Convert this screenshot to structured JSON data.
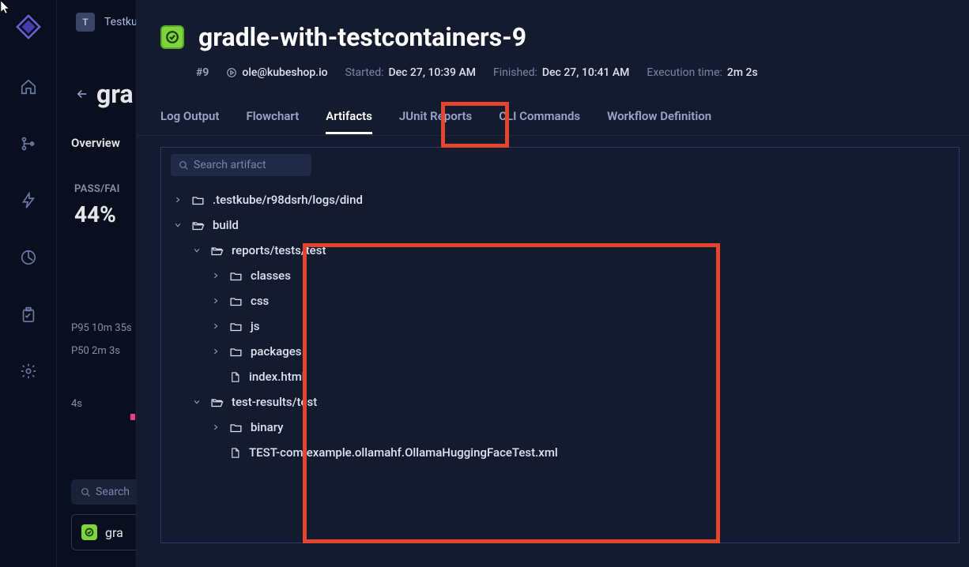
{
  "cursor": {
    "visible": true
  },
  "topbar": {
    "org_initial": "T",
    "org_name": "Testkub"
  },
  "partial": {
    "title": "gra",
    "overview": "Overview",
    "pass_fail_label": "PASS/FAI",
    "pass_fail_pct": "44%",
    "p95": "P95 10m 35s",
    "p50": "P50 2m 3s",
    "p4s": "4s",
    "search_placeholder": "Search",
    "row_name": "gra"
  },
  "main": {
    "title": "gradle-with-testcontainers-9",
    "run_number": "#9",
    "author": "ole@kubeshop.io",
    "started_label": "Started:",
    "started_value": "Dec 27, 10:39 AM",
    "finished_label": "Finished:",
    "finished_value": "Dec 27, 10:41 AM",
    "exec_label": "Execution time:",
    "exec_value": "2m 2s"
  },
  "tabs": {
    "log": "Log Output",
    "flow": "Flowchart",
    "artifacts": "Artifacts",
    "junit": "JUnit Reports",
    "cli": "CLI Commands",
    "workflow": "Workflow Definition"
  },
  "search": {
    "placeholder": "Search artifact"
  },
  "tree": {
    "n1": ".testkube/r98dsrh/logs/dind",
    "n2": "build",
    "n3": "reports/tests/test",
    "n4": "classes",
    "n5": "css",
    "n6": "js",
    "n7": "packages",
    "n8": "index.html",
    "n9": "test-results/test",
    "n10": "binary",
    "n11": "TEST-com.example.ollamahf.OllamaHuggingFaceTest.xml"
  }
}
